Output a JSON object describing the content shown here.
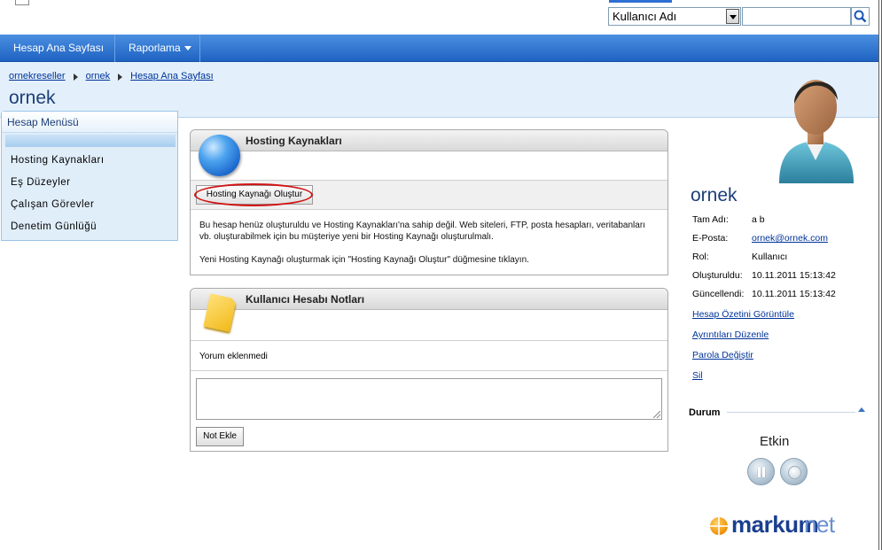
{
  "search": {
    "select_value": "Kullanıcı Adı",
    "input_value": ""
  },
  "nav": {
    "items": [
      {
        "label": "Hesap Ana Sayfası"
      },
      {
        "label": "Raporlama"
      }
    ]
  },
  "breadcrumb": {
    "items": [
      "ornekreseller",
      "ornek",
      "Hesap Ana Sayfası"
    ]
  },
  "page_title": "ornek",
  "sidebar": {
    "title": "Hesap Menüsü",
    "items": [
      "Hosting Kaynakları",
      "Eş Düzeyler",
      "Çalışan Görevler",
      "Denetim Günlüğü"
    ]
  },
  "hosting_panel": {
    "title": "Hosting Kaynakları",
    "create_button": "Hosting Kaynağı Oluştur",
    "text_1": "Bu hesap henüz oluşturuldu ve Hosting Kaynakları'na sahip değil. Web siteleri, FTP, posta hesapları, veritabanları vb. oluşturabilmek için bu müşteriye yeni bir Hosting Kaynağı oluşturulmalı.",
    "text_2": "Yeni Hosting Kaynağı oluşturmak için \"Hosting Kaynağı Oluştur\" düğmesine tıklayın."
  },
  "notes_panel": {
    "title": "Kullanıcı Hesabı Notları",
    "empty_text": "Yorum eklenmedi",
    "note_value": "",
    "add_button": "Not Ekle"
  },
  "user": {
    "name": "ornek",
    "fields": [
      {
        "label": "Tam Adı:",
        "value": "a b"
      },
      {
        "label": "E-Posta:",
        "value": "ornek@ornek.com"
      },
      {
        "label": "Rol:",
        "value": "Kullanıcı"
      },
      {
        "label": "Oluşturuldu:",
        "value": "10.11.2011 15:13:42"
      },
      {
        "label": "Güncellendi:",
        "value": "10.11.2011 15:13:42"
      }
    ],
    "actions": [
      "Hesap Özetini Görüntüle",
      "Ayrıntıları Düzenle",
      "Parola Değiştir",
      "Sil"
    ]
  },
  "status": {
    "heading": "Durum",
    "value": "Etkin"
  },
  "logo": {
    "brand": "markum",
    "tld": "net"
  },
  "colors": {
    "nav_blue": "#1f63c3",
    "title_band": "#e3f0fb",
    "link": "#00339a",
    "highlight_ring": "#d21212"
  }
}
